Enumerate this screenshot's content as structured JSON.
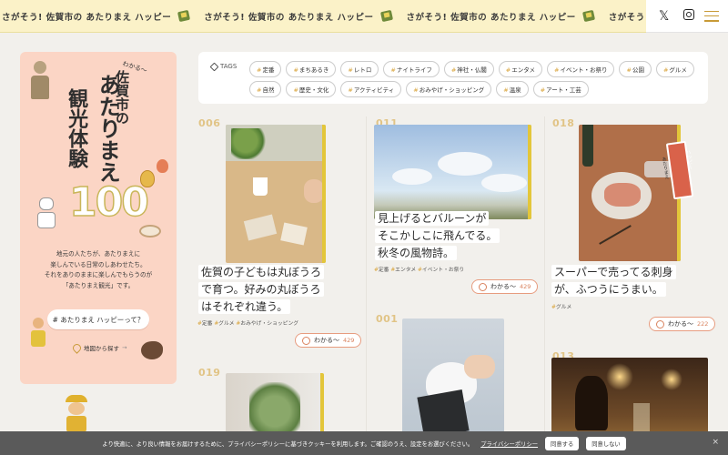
{
  "banner": {
    "items": [
      "さがそう! 佐賀市の あたりまえ ハッピー",
      "さがそう! 佐賀市の あたりまえ ハッピー",
      "さがそう! 佐賀市の あたりまえ ハッピー",
      "さがそう! 佐賀市の あた"
    ]
  },
  "topbar": {
    "x_icon": "𝕏"
  },
  "intro": {
    "wakaru": "わかる〜",
    "city": "佐賀市の",
    "atarimae": "あたりまえ",
    "kanko": "観光体験",
    "number": "100",
    "lines": [
      "地元の人たちが、あたりまえに",
      "楽しんでいる日常のしあわせたち。",
      "それをありのままに楽しんでもらうのが",
      "「あたりまえ観光」です。"
    ],
    "hash_button": "# あたりまえ ハッピーって？",
    "map_link": "地図から探す",
    "map_arrow": "→"
  },
  "tags": {
    "label": "TAGS",
    "row1": [
      "定番",
      "まちあるき",
      "レトロ",
      "ナイトライフ",
      "神社・仏閣",
      "エンタメ",
      "イベント・お祭り",
      "公園",
      "グルメ"
    ],
    "row2": [
      "自然",
      "歴史・文化",
      "アクティビティ",
      "おみやげ・ショッピング",
      "温泉",
      "アート・工芸"
    ]
  },
  "cards": {
    "c006": {
      "num": "006",
      "caption": [
        "佐賀の子どもは丸ぼうろ",
        "で育つ。好みの丸ぼうろ",
        "はそれぞれ違う。"
      ],
      "tags": [
        "定番",
        "グルメ",
        "おみやげ・ショッピング"
      ],
      "wakaru": "わかる〜",
      "count": "429"
    },
    "c011": {
      "num": "011",
      "caption": [
        "見上げるとバルーンが",
        "そこかしこに飛んでる。",
        "秋冬の風物詩。"
      ],
      "tags": [
        "定番",
        "エンタメ",
        "イベント・お祭り"
      ],
      "wakaru": "わかる〜",
      "count": "429"
    },
    "c018": {
      "num": "018",
      "caption": [
        "スーパーで売ってる刺身",
        "が、ふつうにうまい。"
      ],
      "tags": [
        "グルメ"
      ],
      "wakaru": "わかる〜",
      "count": "222",
      "stamp": "あたりまえ",
      "stamp_sub": "ハッピー"
    },
    "c019": {
      "num": "019"
    },
    "c001": {
      "num": "001"
    },
    "c013": {
      "num": "013"
    }
  },
  "cookie": {
    "text": "より快適に、より良い情報をお届けするために、プライバシーポリシーに基づきクッキーを利用します。ご確認のうえ、設定をお選びください。",
    "link": "プライバシーポリシー",
    "agree": "同意する",
    "disagree": "同意しない",
    "close": "×"
  },
  "colors": {
    "accent": "#d9a53d",
    "intro_bg": "#fbd5c5",
    "banner_bg": "#fbf2c8",
    "wakaru_border": "#e79c7f"
  }
}
